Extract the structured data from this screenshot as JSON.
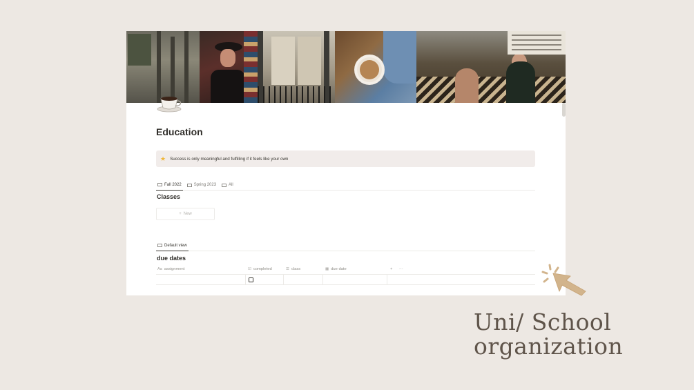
{
  "page": {
    "icon": "coffee-cup-icon",
    "title": "Education",
    "callout": {
      "icon": "star-icon",
      "text": "Success is only meaningful and fulfilling if it feels like your own"
    }
  },
  "semester_tabs": [
    {
      "label": "Fall 2022",
      "icon": "gallery-icon",
      "active": true
    },
    {
      "label": "Spring 2023",
      "icon": "gallery-icon",
      "active": false
    },
    {
      "label": "All",
      "icon": "gallery-icon",
      "active": false
    }
  ],
  "classes": {
    "heading": "Classes",
    "new_label": "New"
  },
  "due_dates": {
    "view_label": "Default view",
    "heading": "due dates",
    "columns": [
      {
        "label": "assignment",
        "icon": "Aa"
      },
      {
        "label": "completed",
        "icon": "checkbox-icon"
      },
      {
        "label": "class",
        "icon": "list-icon"
      },
      {
        "label": "due date",
        "icon": "calendar-icon"
      }
    ],
    "row": {
      "completed": false
    }
  },
  "brand": {
    "line1": "Uni/ School",
    "line2": "organization"
  },
  "colors": {
    "background": "#ede8e3",
    "callout": "#f1ecea",
    "brand_text": "#5f544a",
    "cursor": "#d2b48c"
  }
}
